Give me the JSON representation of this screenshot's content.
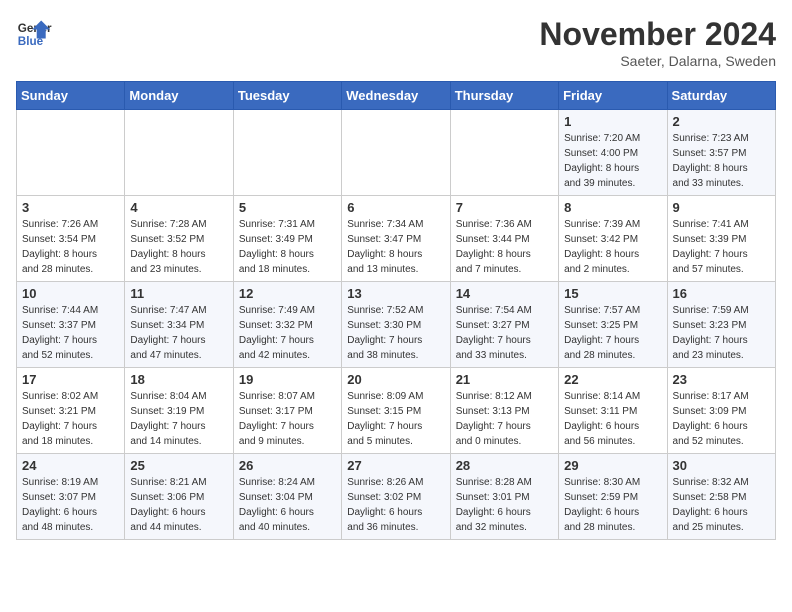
{
  "header": {
    "logo_line1": "General",
    "logo_line2": "Blue",
    "month": "November 2024",
    "location": "Saeter, Dalarna, Sweden"
  },
  "days_of_week": [
    "Sunday",
    "Monday",
    "Tuesday",
    "Wednesday",
    "Thursday",
    "Friday",
    "Saturday"
  ],
  "weeks": [
    [
      {
        "day": "",
        "info": ""
      },
      {
        "day": "",
        "info": ""
      },
      {
        "day": "",
        "info": ""
      },
      {
        "day": "",
        "info": ""
      },
      {
        "day": "",
        "info": ""
      },
      {
        "day": "1",
        "info": "Sunrise: 7:20 AM\nSunset: 4:00 PM\nDaylight: 8 hours\nand 39 minutes."
      },
      {
        "day": "2",
        "info": "Sunrise: 7:23 AM\nSunset: 3:57 PM\nDaylight: 8 hours\nand 33 minutes."
      }
    ],
    [
      {
        "day": "3",
        "info": "Sunrise: 7:26 AM\nSunset: 3:54 PM\nDaylight: 8 hours\nand 28 minutes."
      },
      {
        "day": "4",
        "info": "Sunrise: 7:28 AM\nSunset: 3:52 PM\nDaylight: 8 hours\nand 23 minutes."
      },
      {
        "day": "5",
        "info": "Sunrise: 7:31 AM\nSunset: 3:49 PM\nDaylight: 8 hours\nand 18 minutes."
      },
      {
        "day": "6",
        "info": "Sunrise: 7:34 AM\nSunset: 3:47 PM\nDaylight: 8 hours\nand 13 minutes."
      },
      {
        "day": "7",
        "info": "Sunrise: 7:36 AM\nSunset: 3:44 PM\nDaylight: 8 hours\nand 7 minutes."
      },
      {
        "day": "8",
        "info": "Sunrise: 7:39 AM\nSunset: 3:42 PM\nDaylight: 8 hours\nand 2 minutes."
      },
      {
        "day": "9",
        "info": "Sunrise: 7:41 AM\nSunset: 3:39 PM\nDaylight: 7 hours\nand 57 minutes."
      }
    ],
    [
      {
        "day": "10",
        "info": "Sunrise: 7:44 AM\nSunset: 3:37 PM\nDaylight: 7 hours\nand 52 minutes."
      },
      {
        "day": "11",
        "info": "Sunrise: 7:47 AM\nSunset: 3:34 PM\nDaylight: 7 hours\nand 47 minutes."
      },
      {
        "day": "12",
        "info": "Sunrise: 7:49 AM\nSunset: 3:32 PM\nDaylight: 7 hours\nand 42 minutes."
      },
      {
        "day": "13",
        "info": "Sunrise: 7:52 AM\nSunset: 3:30 PM\nDaylight: 7 hours\nand 38 minutes."
      },
      {
        "day": "14",
        "info": "Sunrise: 7:54 AM\nSunset: 3:27 PM\nDaylight: 7 hours\nand 33 minutes."
      },
      {
        "day": "15",
        "info": "Sunrise: 7:57 AM\nSunset: 3:25 PM\nDaylight: 7 hours\nand 28 minutes."
      },
      {
        "day": "16",
        "info": "Sunrise: 7:59 AM\nSunset: 3:23 PM\nDaylight: 7 hours\nand 23 minutes."
      }
    ],
    [
      {
        "day": "17",
        "info": "Sunrise: 8:02 AM\nSunset: 3:21 PM\nDaylight: 7 hours\nand 18 minutes."
      },
      {
        "day": "18",
        "info": "Sunrise: 8:04 AM\nSunset: 3:19 PM\nDaylight: 7 hours\nand 14 minutes."
      },
      {
        "day": "19",
        "info": "Sunrise: 8:07 AM\nSunset: 3:17 PM\nDaylight: 7 hours\nand 9 minutes."
      },
      {
        "day": "20",
        "info": "Sunrise: 8:09 AM\nSunset: 3:15 PM\nDaylight: 7 hours\nand 5 minutes."
      },
      {
        "day": "21",
        "info": "Sunrise: 8:12 AM\nSunset: 3:13 PM\nDaylight: 7 hours\nand 0 minutes."
      },
      {
        "day": "22",
        "info": "Sunrise: 8:14 AM\nSunset: 3:11 PM\nDaylight: 6 hours\nand 56 minutes."
      },
      {
        "day": "23",
        "info": "Sunrise: 8:17 AM\nSunset: 3:09 PM\nDaylight: 6 hours\nand 52 minutes."
      }
    ],
    [
      {
        "day": "24",
        "info": "Sunrise: 8:19 AM\nSunset: 3:07 PM\nDaylight: 6 hours\nand 48 minutes."
      },
      {
        "day": "25",
        "info": "Sunrise: 8:21 AM\nSunset: 3:06 PM\nDaylight: 6 hours\nand 44 minutes."
      },
      {
        "day": "26",
        "info": "Sunrise: 8:24 AM\nSunset: 3:04 PM\nDaylight: 6 hours\nand 40 minutes."
      },
      {
        "day": "27",
        "info": "Sunrise: 8:26 AM\nSunset: 3:02 PM\nDaylight: 6 hours\nand 36 minutes."
      },
      {
        "day": "28",
        "info": "Sunrise: 8:28 AM\nSunset: 3:01 PM\nDaylight: 6 hours\nand 32 minutes."
      },
      {
        "day": "29",
        "info": "Sunrise: 8:30 AM\nSunset: 2:59 PM\nDaylight: 6 hours\nand 28 minutes."
      },
      {
        "day": "30",
        "info": "Sunrise: 8:32 AM\nSunset: 2:58 PM\nDaylight: 6 hours\nand 25 minutes."
      }
    ]
  ]
}
